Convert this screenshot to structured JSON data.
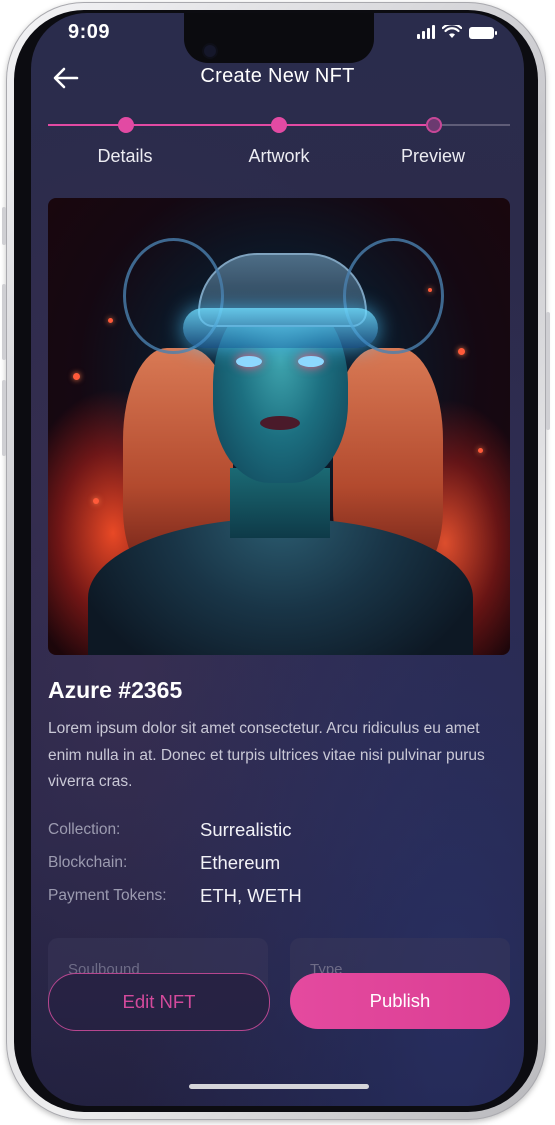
{
  "status_bar": {
    "time": "9:09"
  },
  "header": {
    "title": "Create New NFT"
  },
  "stepper": {
    "steps": [
      {
        "label": "Details",
        "state": "done"
      },
      {
        "label": "Artwork",
        "state": "done"
      },
      {
        "label": "Preview",
        "state": "current"
      }
    ]
  },
  "artwork": {
    "subject": "cyberpunk woman portrait with glowing visor"
  },
  "nft": {
    "name": "Azure #2365",
    "description": "Lorem ipsum dolor sit amet consectetur. Arcu ridiculus eu amet enim nulla in at. Donec et turpis ultrices vitae nisi pulvinar purus viverra cras."
  },
  "details": [
    {
      "label": "Collection:",
      "value": "Surrealistic"
    },
    {
      "label": "Blockchain:",
      "value": "Ethereum"
    },
    {
      "label": "Payment Tokens:",
      "value": "ETH, WETH"
    }
  ],
  "fields": [
    {
      "label": "Soulbound"
    },
    {
      "label": "Type"
    }
  ],
  "buttons": {
    "edit": "Edit NFT",
    "publish": "Publish"
  },
  "colors": {
    "accent": "#e24aa3",
    "background": "#2a2c4c"
  }
}
